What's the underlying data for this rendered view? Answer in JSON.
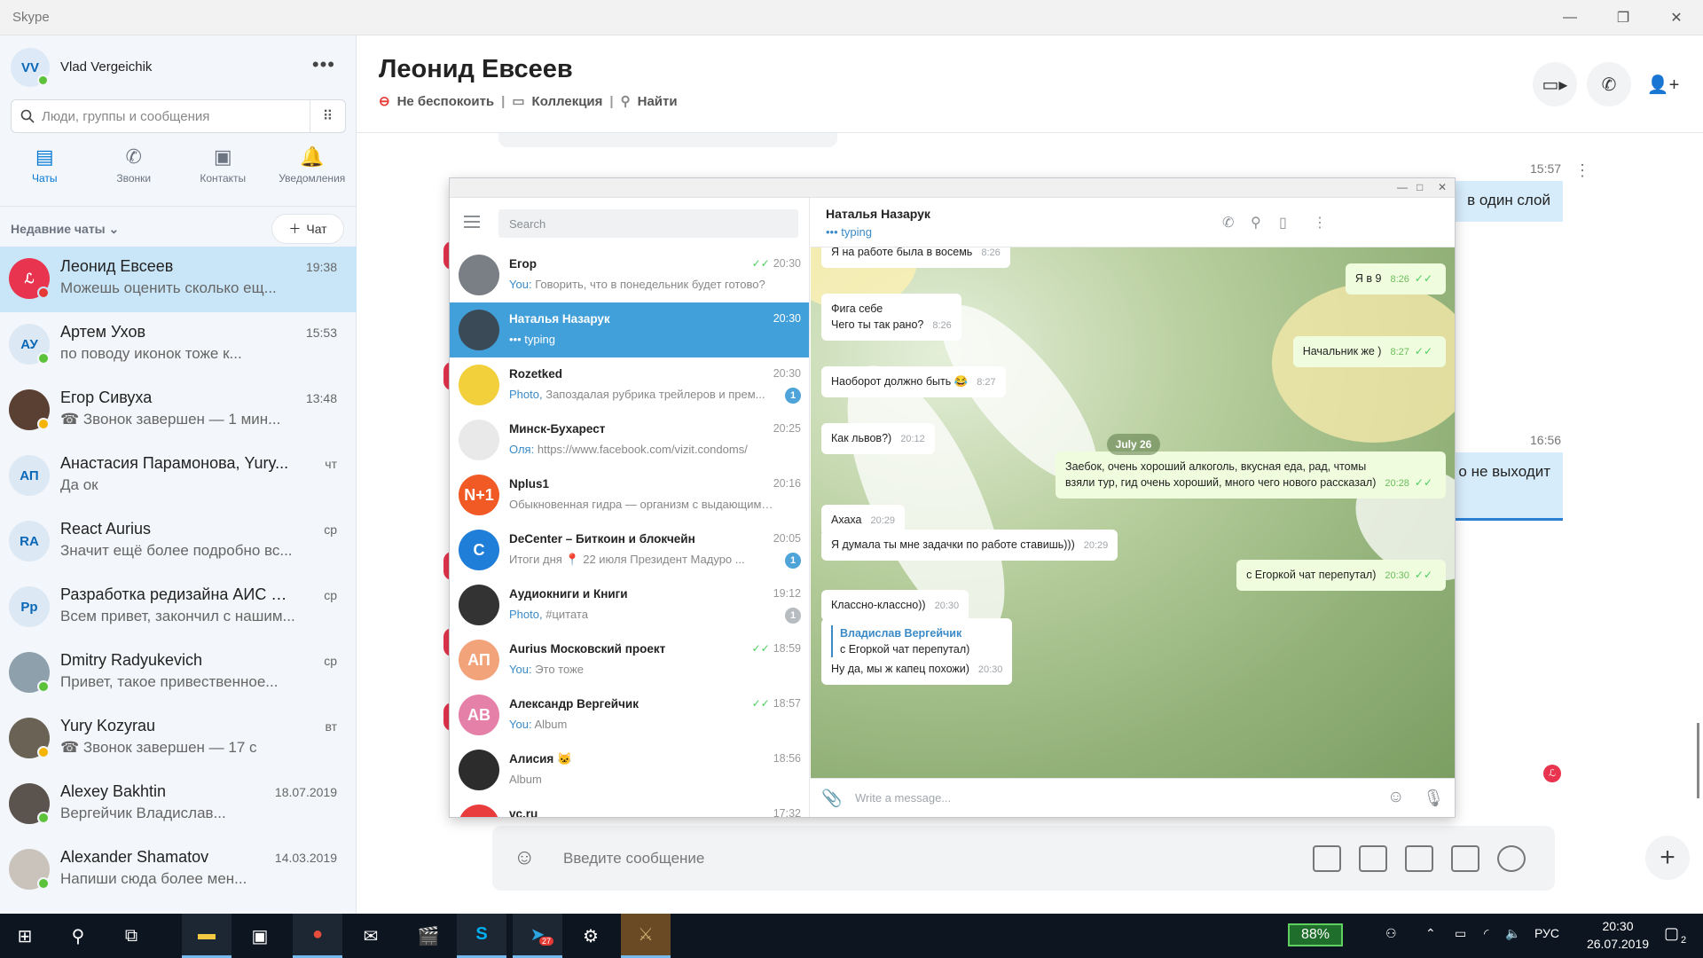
{
  "window": {
    "title": "Skype"
  },
  "me": {
    "initials": "VV",
    "name": "Vlad Vergeichik"
  },
  "search": {
    "placeholder": "Люди, группы и сообщения"
  },
  "nav": [
    {
      "label": "Чаты",
      "icon": "chat-icon"
    },
    {
      "label": "Звонки",
      "icon": "phone-icon"
    },
    {
      "label": "Контакты",
      "icon": "contacts-icon"
    },
    {
      "label": "Уведомления",
      "icon": "bell-icon"
    }
  ],
  "recent": {
    "label": "Недавние чаты",
    "new_chat": "Чат"
  },
  "chats": [
    {
      "name": "Леонид Евсеев",
      "time": "19:38",
      "preview": "Можешь оценить сколько ещ..."
    },
    {
      "initials": "АУ",
      "name": "Артем Ухов",
      "time": "15:53",
      "preview": "по поводу иконок тоже к..."
    },
    {
      "name": "Егор Сивуха",
      "time": "13:48",
      "preview": "☎ Звонок завершен — 1 мин..."
    },
    {
      "initials": "АП",
      "name": "Анастасия Парамонова, Yury...",
      "time": "чт",
      "preview": "Да ок"
    },
    {
      "initials": "RA",
      "name": "React Aurius",
      "time": "ср",
      "preview": "Значит ещё более подробно вс..."
    },
    {
      "initials": "Рр",
      "name": "Разработка редизайна АИС УИД",
      "time": "ср",
      "preview": "Всем привет, закончил с нашим..."
    },
    {
      "name": "Dmitry Radyukevich",
      "time": "ср",
      "preview": "Привет, такое привественное..."
    },
    {
      "name": "Yury Kozyrau",
      "time": "вт",
      "preview": "☎ Звонок завершен — 17 с"
    },
    {
      "name": "Alexey Bakhtin",
      "time": "18.07.2019",
      "preview": "Вергейчик Владислав..."
    },
    {
      "name": "Alexander Shamatov",
      "time": "14.03.2019",
      "preview": "Напиши сюда более мен..."
    }
  ],
  "conversation": {
    "title": "Леонид Евсеев",
    "status": "Не беспокоить",
    "collection": "Коллекция",
    "find": "Найти",
    "time1": "15:57",
    "msg1": "в один слой",
    "time2": "16:56",
    "msg2": "о не выходит",
    "composer_placeholder": "Введите сообщение"
  },
  "telegram": {
    "search_placeholder": "Search",
    "chats": [
      {
        "name": "Егор",
        "time": "20:30",
        "prefix": "You:",
        "preview": "Говорить, что в понедельник будет готово?",
        "av_color": "#7a7f86"
      },
      {
        "name": "Наталья Назарук",
        "time": "20:30",
        "prefix": "•••",
        "preview": "typing",
        "av_color": "#3b4a57"
      },
      {
        "name": "Rozetked",
        "time": "20:30",
        "prefix": "Photo,",
        "preview": "Запоздалая рубрика трейлеров и прем...",
        "badge": "1",
        "av_color": "#f2d03b"
      },
      {
        "name": "Минск-Бухарест",
        "time": "20:25",
        "prefix": "Оля:",
        "preview": "https://www.facebook.com/vizit.condoms/",
        "av_color": "#e9e9e9"
      },
      {
        "name": "Nplus1",
        "time": "20:16",
        "prefix": "",
        "preview": "Обыкновенная гидра — организм с выдающимис...",
        "av_color": "#f15a24",
        "av_text": "N+1"
      },
      {
        "name": "DeCenter – Биткоин и блокчейн",
        "time": "20:05",
        "prefix": "",
        "preview": "Итоги дня 📍 22 июля Президент Мадуро ...",
        "badge": "1",
        "av_color": "#1f7ed8",
        "av_text": "C"
      },
      {
        "name": "Аудиокниги и Книги",
        "time": "19:12",
        "prefix": "Photo,",
        "preview": "#цитата",
        "badge": "1",
        "badge_grey": true,
        "av_color": "#333"
      },
      {
        "name": "Aurius Московский проект",
        "time": "18:59",
        "prefix": "You:",
        "preview": "Это тоже",
        "av_color": "#f3a37a",
        "av_text": "АП"
      },
      {
        "name": "Александр Вергейчик",
        "time": "18:57",
        "prefix": "You:",
        "preview": "Album",
        "av_color": "#e580a8",
        "av_text": "AB"
      },
      {
        "name": "Алисия 🐱",
        "time": "18:56",
        "prefix": "",
        "preview": "Album",
        "av_color": "#2c2c2c"
      },
      {
        "name": "vc.ru",
        "time": "17:32",
        "prefix": "",
        "preview": "",
        "av_color": "#e93c3c",
        "av_text": "VC"
      }
    ],
    "active": {
      "name": "Наталья Назарук",
      "status": "typing"
    },
    "messages": [
      {
        "dir": "in",
        "text": "Я на работе была в восемь",
        "time": "8:26"
      },
      {
        "dir": "out",
        "text": "Я в 9",
        "time": "8:26"
      },
      {
        "dir": "in",
        "text": "Фига себе",
        "text2": "Чего ты так рано?",
        "time": "8:26"
      },
      {
        "dir": "out",
        "text": "Начальник же )",
        "time": "8:27"
      },
      {
        "dir": "in",
        "text": "Наоборот должно быть 😂",
        "time": "8:27"
      },
      {
        "dir": "in",
        "text": "Как львов?)",
        "time": "20:12"
      },
      {
        "dir": "out",
        "text": "Заебок, очень хороший алкоголь, вкусная еда, рад, чтомы",
        "text2": "взяли тур, гид очень хороший, много чего нового рассказал)",
        "time": "20:28"
      },
      {
        "dir": "in",
        "text": "Ахаха",
        "time": "20:29"
      },
      {
        "dir": "in",
        "text": "Я думала ты мне задачки по работе ставишь)))",
        "time": "20:29"
      },
      {
        "dir": "out",
        "text": "с Егоркой чат перепутал)",
        "time": "20:30"
      },
      {
        "dir": "in",
        "text": "Классно-классно))",
        "time": "20:30"
      },
      {
        "dir": "in",
        "reply_name": "Владислав Вергейчик",
        "reply_text": "с Егоркой чат перепутал)",
        "text": "Ну да, мы ж капец похожи)",
        "time": "20:30"
      }
    ],
    "date_chip": "July 26",
    "input_placeholder": "Write a message..."
  },
  "taskbar": {
    "battery": "88%",
    "lang": "РУС",
    "time": "20:30",
    "date": "26.07.2019",
    "telegram_badge": "27",
    "notif_count": "2"
  }
}
